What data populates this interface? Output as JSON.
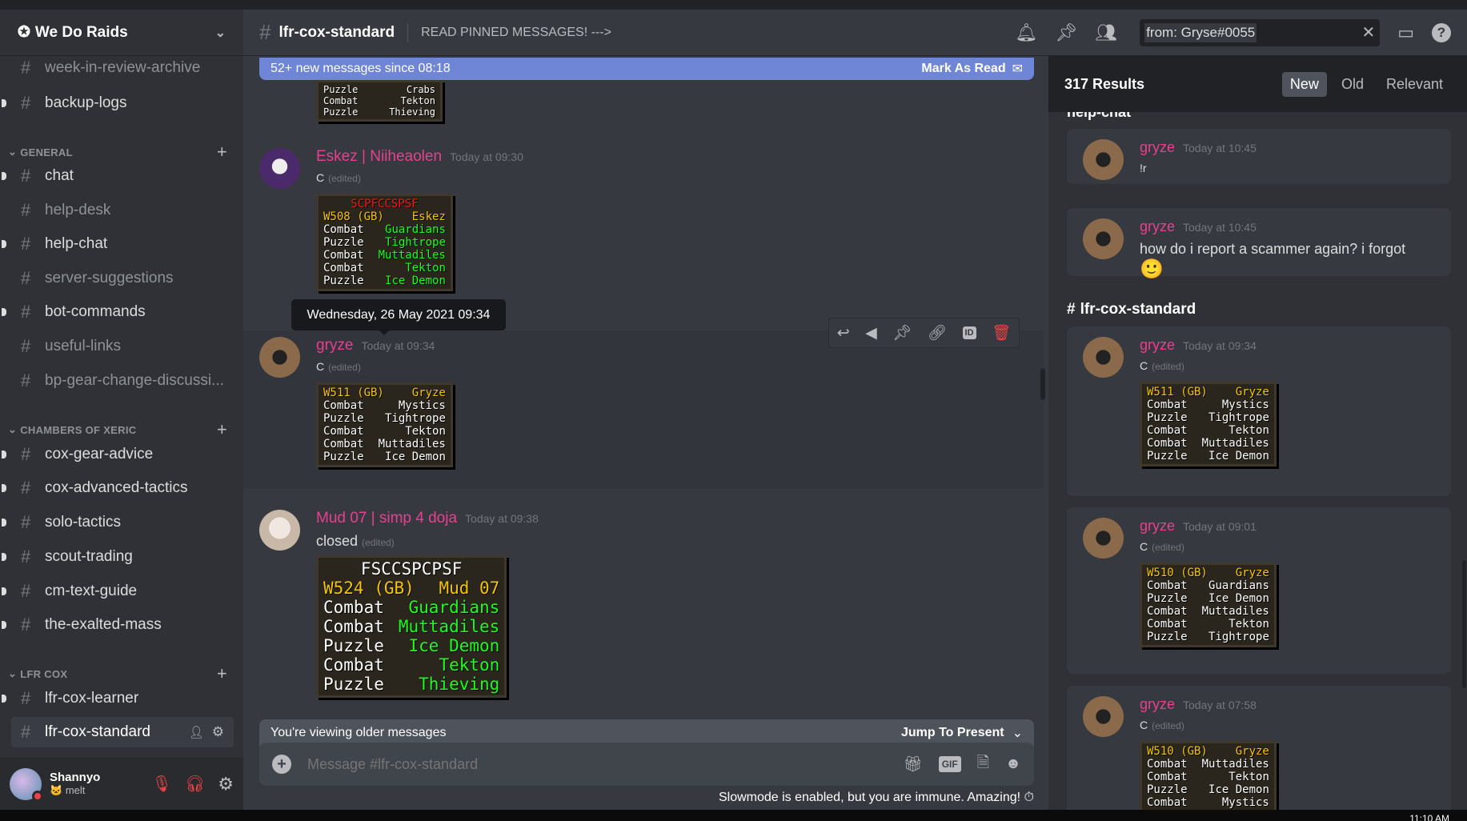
{
  "server": {
    "name": "We Do Raids"
  },
  "sidebar": {
    "channels_top": [
      {
        "name": "week-in-review-archive",
        "muted": true,
        "unread": false
      },
      {
        "name": "backup-logs",
        "muted": false,
        "unread": true
      }
    ],
    "categories": [
      {
        "name": "GENERAL",
        "channels": [
          {
            "name": "chat",
            "muted": false,
            "unread": true
          },
          {
            "name": "help-desk",
            "muted": true,
            "unread": false
          },
          {
            "name": "help-chat",
            "muted": false,
            "unread": true
          },
          {
            "name": "server-suggestions",
            "muted": true,
            "unread": false
          },
          {
            "name": "bot-commands",
            "muted": false,
            "unread": true
          },
          {
            "name": "useful-links",
            "muted": true,
            "unread": false
          },
          {
            "name": "bp-gear-change-discussi...",
            "muted": true,
            "unread": false
          }
        ]
      },
      {
        "name": "CHAMBERS OF XERIC",
        "channels": [
          {
            "name": "cox-gear-advice",
            "muted": false,
            "unread": true
          },
          {
            "name": "cox-advanced-tactics",
            "muted": false,
            "unread": true
          },
          {
            "name": "solo-tactics",
            "muted": false,
            "unread": true
          },
          {
            "name": "scout-trading",
            "muted": false,
            "unread": true
          },
          {
            "name": "cm-text-guide",
            "muted": false,
            "unread": true
          },
          {
            "name": "the-exalted-mass",
            "muted": false,
            "unread": true
          }
        ]
      },
      {
        "name": "LFR COX",
        "channels": [
          {
            "name": "lfr-cox-learner",
            "muted": false,
            "unread": true
          },
          {
            "name": "lfr-cox-standard",
            "muted": false,
            "unread": false,
            "selected": true
          }
        ]
      }
    ],
    "user": {
      "name": "Shannyo",
      "status": "melt"
    }
  },
  "header": {
    "channel": "lfr-cox-standard",
    "topic": "READ PINNED MESSAGES! --->",
    "search_value": "from: Gryse#0055"
  },
  "chat": {
    "new_messages_bar": "52+ new messages since 08:18",
    "mark_as_read": "Mark As Read",
    "top_partial_table": [
      [
        "Puzzle",
        "Crabs"
      ],
      [
        "Combat",
        "Tekton"
      ],
      [
        "Puzzle",
        "Thieving"
      ]
    ],
    "tooltip": "Wednesday, 26 May 2021 09:34",
    "messages": [
      {
        "author": "Eskez | Niiheaolen",
        "time": "Today at 09:30",
        "text": "C",
        "edited": "(edited)",
        "table": {
          "head": "SCPFCCSPSF",
          "head_color": "red",
          "title": [
            "W508 (GB)",
            "Eskez"
          ],
          "rows": [
            [
              "Combat",
              "Guardians"
            ],
            [
              "Puzzle",
              "Tightrope"
            ],
            [
              "Combat",
              "Muttadiles"
            ],
            [
              "Combat",
              "Tekton"
            ],
            [
              "Puzzle",
              "Ice Demon"
            ]
          ],
          "value_color": "green"
        }
      },
      {
        "author": "gryze",
        "time": "Today at 09:34",
        "text": "C",
        "edited": "(edited)",
        "table": {
          "title": [
            "W511 (GB)",
            "Gryze"
          ],
          "rows": [
            [
              "Combat",
              "Mystics"
            ],
            [
              "Puzzle",
              "Tightrope"
            ],
            [
              "Combat",
              "Tekton"
            ],
            [
              "Combat",
              "Muttadiles"
            ],
            [
              "Puzzle",
              "Ice Demon"
            ]
          ],
          "value_color": "white"
        }
      },
      {
        "author": "Mud 07 | simp 4 doja",
        "time": "Today at 09:38",
        "text": "closed",
        "edited": "(edited)",
        "table": {
          "head": "FSCCSPCPSF",
          "head_color": "white",
          "title": [
            "W524 (GB)",
            "Mud 07"
          ],
          "rows": [
            [
              "Combat",
              "Guardians"
            ],
            [
              "Combat",
              "Muttadiles"
            ],
            [
              "Puzzle",
              "Ice Demon"
            ],
            [
              "Combat",
              "Tekton"
            ],
            [
              "Puzzle",
              "Thieving"
            ]
          ],
          "value_color": "green"
        }
      }
    ],
    "older_messages": "You're viewing older messages",
    "jump_to_present": "Jump To Present",
    "input_placeholder": "Message #lfr-cox-standard",
    "gif_label": "GIF",
    "slowmode": "Slowmode is enabled, but you are immune. Amazing!"
  },
  "results": {
    "count": "317 Results",
    "sort": [
      "New",
      "Old",
      "Relevant"
    ],
    "active_sort": "New",
    "group1_partial": "help-chat",
    "group1": [
      {
        "author": "gryze",
        "time": "Today at 10:45",
        "text": "!r"
      },
      {
        "author": "gryze",
        "time": "Today at 10:45",
        "text": "how do i report a scammer again? i forgot",
        "emoji": "🙂"
      }
    ],
    "group2_channel": "lfr-cox-standard",
    "group2": [
      {
        "author": "gryze",
        "time": "Today at 09:34",
        "text": "C",
        "edited": "(edited)",
        "table": {
          "title": [
            "W511 (GB)",
            "Gryze"
          ],
          "rows": [
            [
              "Combat",
              "Mystics"
            ],
            [
              "Puzzle",
              "Tightrope"
            ],
            [
              "Combat",
              "Tekton"
            ],
            [
              "Combat",
              "Muttadiles"
            ],
            [
              "Puzzle",
              "Ice Demon"
            ]
          ],
          "value_color": "white"
        }
      },
      {
        "author": "gryze",
        "time": "Today at 09:01",
        "text": "C",
        "edited": "(edited)",
        "table": {
          "title": [
            "W510 (GB)",
            "Gryze"
          ],
          "rows": [
            [
              "Combat",
              "Guardians"
            ],
            [
              "Puzzle",
              "Ice Demon"
            ],
            [
              "Combat",
              "Muttadiles"
            ],
            [
              "Combat",
              "Tekton"
            ],
            [
              "Puzzle",
              "Tightrope"
            ]
          ],
          "value_color": "white"
        }
      },
      {
        "author": "gryze",
        "time": "Today at 07:58",
        "text": "C",
        "edited": "(edited)",
        "table": {
          "title": [
            "W510 (GB)",
            "Gryze"
          ],
          "rows": [
            [
              "Combat",
              "Muttadiles"
            ],
            [
              "Combat",
              "Tekton"
            ],
            [
              "Puzzle",
              "Ice Demon"
            ],
            [
              "Combat",
              "Mystics"
            ]
          ],
          "value_color": "white"
        }
      }
    ]
  },
  "taskbar": {
    "clock": "11:10 AM"
  },
  "colors": {
    "accent": "#7289da",
    "username": "#ea3f8f",
    "danger": "#ed4245"
  }
}
